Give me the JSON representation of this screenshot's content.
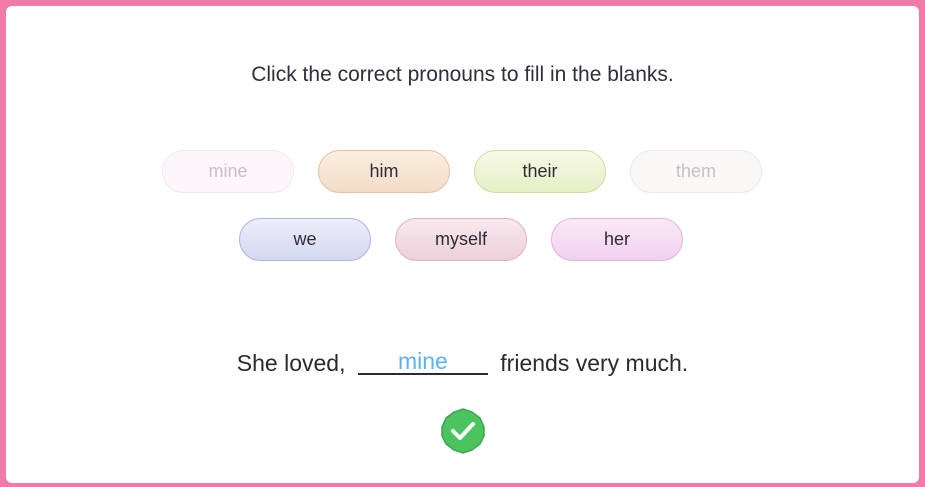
{
  "instruction": "Click the correct pronouns to fill in the blanks.",
  "options_row1": [
    "mine",
    "him",
    "their",
    "them"
  ],
  "options_row2": [
    "we",
    "myself",
    "her"
  ],
  "sentence": {
    "before": "She loved,",
    "answer": "mine",
    "after": "friends very much."
  },
  "colors": {
    "border": "#f07aa8",
    "answer_text": "#5ab4ec",
    "check": "#4bc45f"
  },
  "check_icon": "check-circle-icon"
}
